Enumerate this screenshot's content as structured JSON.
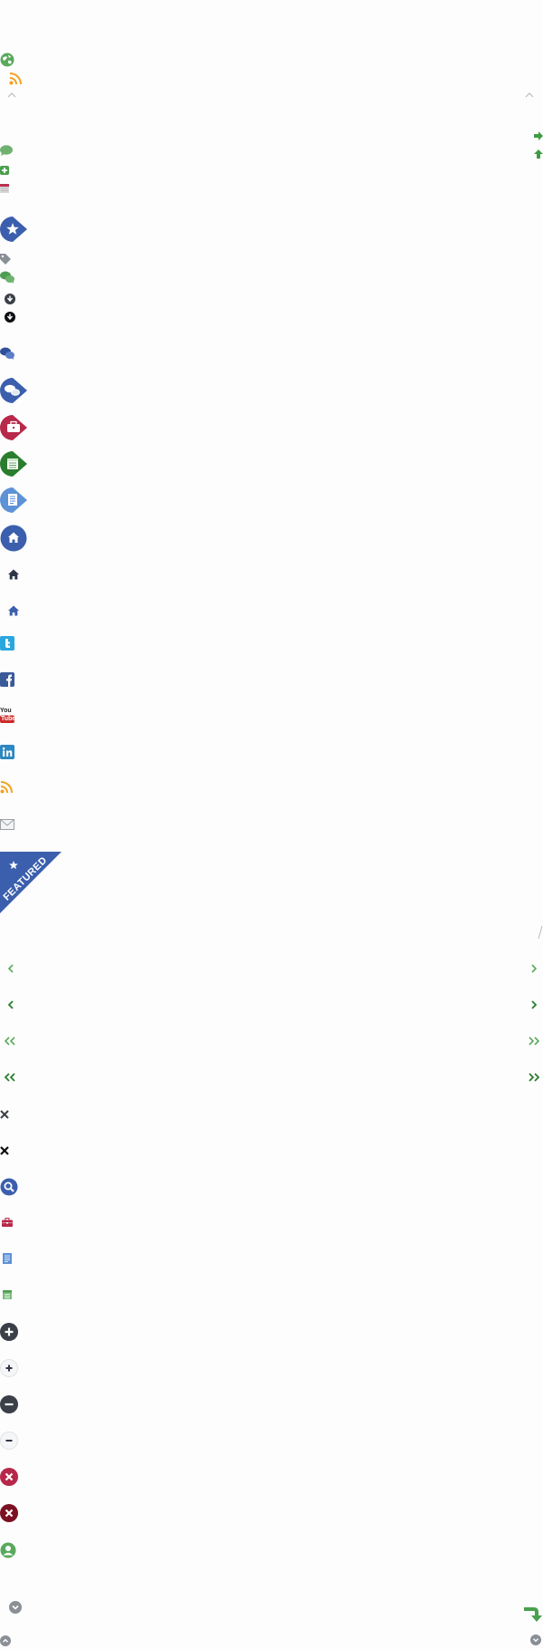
{
  "colors": {
    "green": "#5aa95c",
    "dark_green": "#2a7d2e",
    "blue": "#3b5fad",
    "light_blue": "#5d92d6",
    "crimson": "#b7284a",
    "orange": "#f4a11c",
    "navy": "#2e3646",
    "twitter": "#2aa6df",
    "facebook": "#3b5a9a",
    "linkedin": "#2d87c0",
    "youtube": "#cc2a2a",
    "grey": "#9aa0a6"
  },
  "sprite": {
    "featured_label": "FEATURED",
    "youtube_text_top": "You",
    "youtube_text_bottom": "Tube"
  },
  "icons": [
    "globe-icon",
    "rss-icon",
    "caret-up-icon",
    "caret-up-icon",
    "arrow-right-icon",
    "arrow-up-icon",
    "comment-icon",
    "plus-square-icon",
    "calendar-small-icon",
    "star-badge-icon",
    "tag-icon",
    "comments-icon",
    "download-circle-icon",
    "download-circle-dark-icon",
    "comments-blue-icon",
    "comments-badge-icon",
    "briefcase-badge-icon",
    "calendar-badge-icon",
    "document-badge-icon",
    "home-badge-icon",
    "home-dark-icon",
    "home-blue-icon",
    "twitter-icon",
    "facebook-icon",
    "youtube-icon",
    "linkedin-icon",
    "rss-feed-icon",
    "mail-icon",
    "featured-ribbon",
    "divider-slash",
    "chevron-left-icon",
    "chevron-right-icon",
    "double-chevron-left-icon",
    "double-chevron-right-icon",
    "close-x-icon",
    "search-icon",
    "briefcase-icon",
    "document-icon",
    "calendar-icon",
    "plus-circle-icon",
    "minus-circle-icon",
    "remove-circle-icon",
    "user-circle-icon",
    "chevron-down-circle-icon",
    "reply-arrow-icon",
    "chevron-up-circle-icon"
  ]
}
